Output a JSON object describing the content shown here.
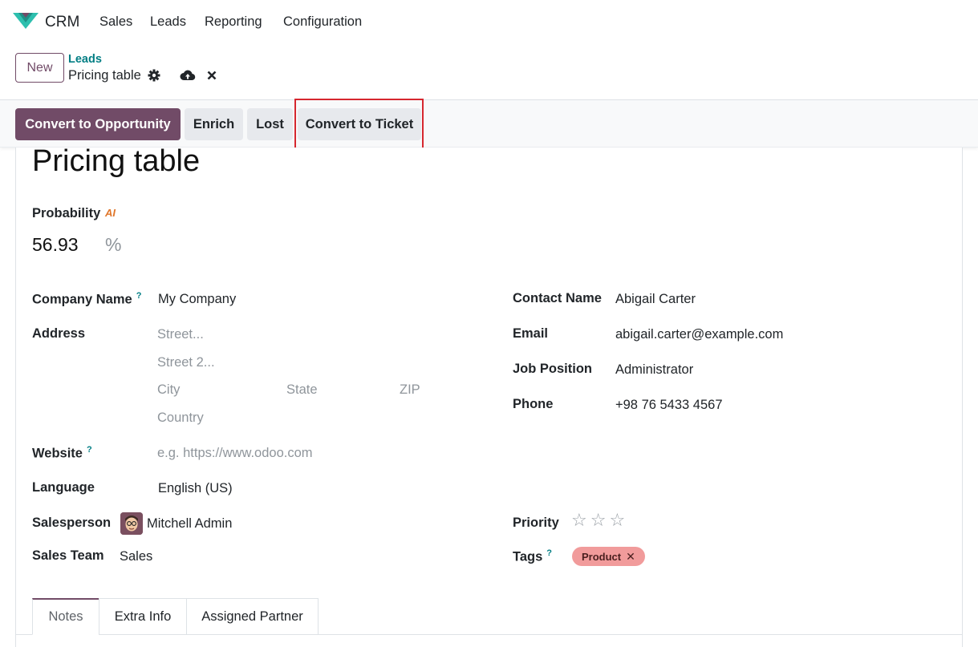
{
  "app": {
    "name": "CRM"
  },
  "nav": [
    "Sales",
    "Leads",
    "Reporting",
    "Configuration"
  ],
  "control": {
    "new_label": "New",
    "breadcrumb_parent": "Leads",
    "breadcrumb_current": "Pricing table"
  },
  "actions": {
    "convert_opportunity": "Convert to Opportunity",
    "enrich": "Enrich",
    "lost": "Lost",
    "convert_ticket": "Convert to Ticket"
  },
  "record": {
    "title": "Pricing table",
    "probability_label": "Probability",
    "ai_badge": "AI",
    "probability_value": "56.93",
    "probability_unit": "%"
  },
  "left": {
    "company_name_label": "Company Name",
    "company_name_value": "My Company",
    "address_label": "Address",
    "street_ph": "Street...",
    "street2_ph": "Street 2...",
    "city_ph": "City",
    "state_ph": "State",
    "zip_ph": "ZIP",
    "country_ph": "Country",
    "website_label": "Website",
    "website_ph": "e.g. https://www.odoo.com",
    "language_label": "Language",
    "language_value": "English (US)",
    "salesperson_label": "Salesperson",
    "salesperson_value": "Mitchell Admin",
    "sales_team_label": "Sales Team",
    "sales_team_value": "Sales"
  },
  "right": {
    "contact_name_label": "Contact Name",
    "contact_name_value": "Abigail Carter",
    "email_label": "Email",
    "email_value": "abigail.carter@example.com",
    "job_position_label": "Job Position",
    "job_position_value": "Administrator",
    "phone_label": "Phone",
    "phone_value": "+98 76 5433 4567",
    "priority_label": "Priority",
    "priority_stars": 0,
    "priority_max": 3,
    "tags_label": "Tags",
    "tags": [
      "Product"
    ]
  },
  "help_mark": "?",
  "tabs": [
    "Notes",
    "Extra Info",
    "Assigned Partner"
  ],
  "colors": {
    "brand": "#714b67",
    "link": "#017e84",
    "tag": "#f19b9b",
    "highlight": "#d6272f"
  }
}
